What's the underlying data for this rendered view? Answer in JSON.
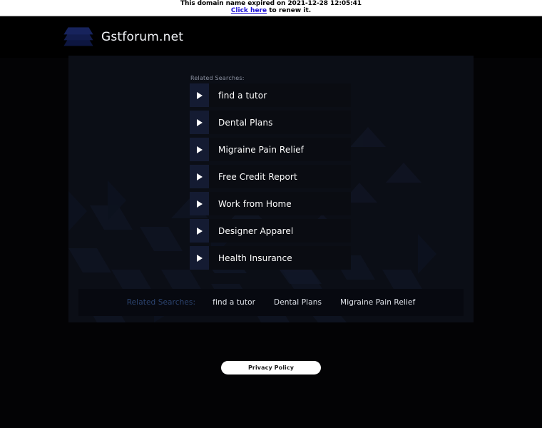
{
  "banner": {
    "message": "This domain name expired on 2021-12-28 12:05:41",
    "link_text": "Click here",
    "link_tail": " to renew it."
  },
  "header": {
    "site_name": "Gstforum.net",
    "logo_icon": "stacked-layers-icon"
  },
  "panel": {
    "related_label": "Related Searches:",
    "items": [
      {
        "label": "find a tutor",
        "icon": "play-arrow-icon"
      },
      {
        "label": "Dental Plans",
        "icon": "play-arrow-icon"
      },
      {
        "label": "Migraine Pain Relief",
        "icon": "play-arrow-icon"
      },
      {
        "label": "Free Credit Report",
        "icon": "play-arrow-icon"
      },
      {
        "label": "Work from Home",
        "icon": "play-arrow-icon"
      },
      {
        "label": "Designer Apparel",
        "icon": "play-arrow-icon"
      },
      {
        "label": "Health Insurance",
        "icon": "play-arrow-icon"
      }
    ],
    "footer_bar": {
      "label": "Related Searches:",
      "links": [
        "find a tutor",
        "Dental Plans",
        "Migraine Pain Relief"
      ]
    }
  },
  "footer": {
    "privacy_label": "Privacy Policy"
  },
  "colors": {
    "page_background": "#030305",
    "panel_background": "#0b0e16",
    "row_background": "#0a0c12",
    "arrow_cell_background": "#141b32",
    "link_blue": "#1a0dd6",
    "muted_blue": "#2c4470",
    "logo_blue": "#17235c"
  }
}
